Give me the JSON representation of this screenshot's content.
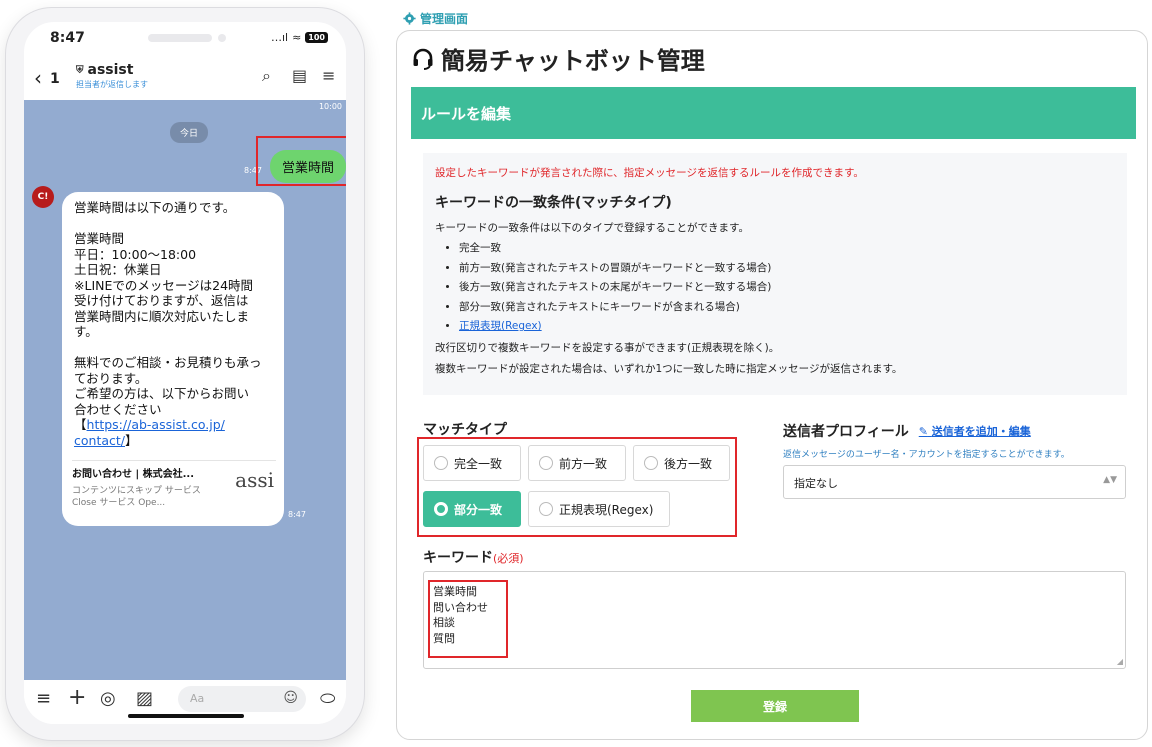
{
  "phone": {
    "status_time": "8:47",
    "status_signal": "…ıl",
    "status_wifi": "≈",
    "battery": "100",
    "back_glyph": "‹",
    "back_count": "1",
    "room_name": "assist",
    "room_sub": "担当者が返信します",
    "header_icons": {
      "search": "⌕",
      "notes": "▤",
      "menu": "≡"
    },
    "top_time": "10:00",
    "date_pill": "今日",
    "user_message": "営業時間",
    "user_time": "8:47",
    "bot_avatar": "C!",
    "bot_lines": [
      "営業時間は以下の通りです。",
      "",
      "営業時間",
      "平日：10:00〜18:00",
      "土日祝：休業日",
      "※LINEでのメッセージは24時間",
      "受け付けておりますが、返信は",
      "営業時間内に順次対応いたしま",
      "す。",
      "",
      "無料でのご相談・お見積りも承っ",
      "ております。",
      "ご希望の方は、以下からお問い",
      "合わせください"
    ],
    "bot_link_open": "【",
    "bot_link_1": "https://ab-assist.co.jp/",
    "bot_link_2": "contact/",
    "bot_link_close": "】",
    "preview_title": "お問い合わせ | 株式会社...",
    "preview_desc": "コンテンツにスキップ サービス Close サービス Ope...",
    "preview_logo": "assi",
    "bot_time": "8:47",
    "input_placeholder": "Aa",
    "input_icons": {
      "menu": "≡",
      "plus": "+",
      "camera": "◎",
      "image": "▨",
      "emoji": "☺",
      "mic": "⬭"
    }
  },
  "admin": {
    "label": "管理画面",
    "title": "簡易チャットボット管理",
    "section_header": "ルールを編集",
    "info": {
      "warning": "設定したキーワードが発言された際に、指定メッセージを返信するルールを作成できます。",
      "heading": "キーワードの一致条件(マッチタイプ)",
      "intro": "キーワードの一致条件は以下のタイプで登録することができます。",
      "items": [
        "完全一致",
        "前方一致(発言されたテキストの冒頭がキーワードと一致する場合)",
        "後方一致(発言されたテキストの末尾がキーワードと一致する場合)",
        "部分一致(発言されたテキストにキーワードが含まれる場合)"
      ],
      "regex_link": "正規表現(Regex)",
      "note1": "改行区切りで複数キーワードを設定する事ができます(正規表現を除く)。",
      "note2": "複数キーワードが設定された場合は、いずれか1つに一致した時に指定メッセージが返信されます。"
    },
    "match_type": {
      "label": "マッチタイプ",
      "options": [
        "完全一致",
        "前方一致",
        "後方一致",
        "部分一致",
        "正規表現(Regex)"
      ],
      "selected": "部分一致"
    },
    "sender": {
      "label": "送信者プロフィール",
      "link": "送信者を追加・編集",
      "description": "返信メッセージのユーザー名・アカウントを指定することができます。",
      "selected": "指定なし"
    },
    "keyword": {
      "label": "キーワード",
      "required": "(必須)",
      "values": [
        "営業時間",
        "問い合わせ",
        "相談",
        "質問"
      ]
    },
    "submit_label": "登録"
  },
  "colors": {
    "accent": "#3dbd99",
    "submit": "#7fc550",
    "highlight": "#e0262a",
    "chat_bg": "#93abd0",
    "user_bubble": "#6ed46e"
  }
}
